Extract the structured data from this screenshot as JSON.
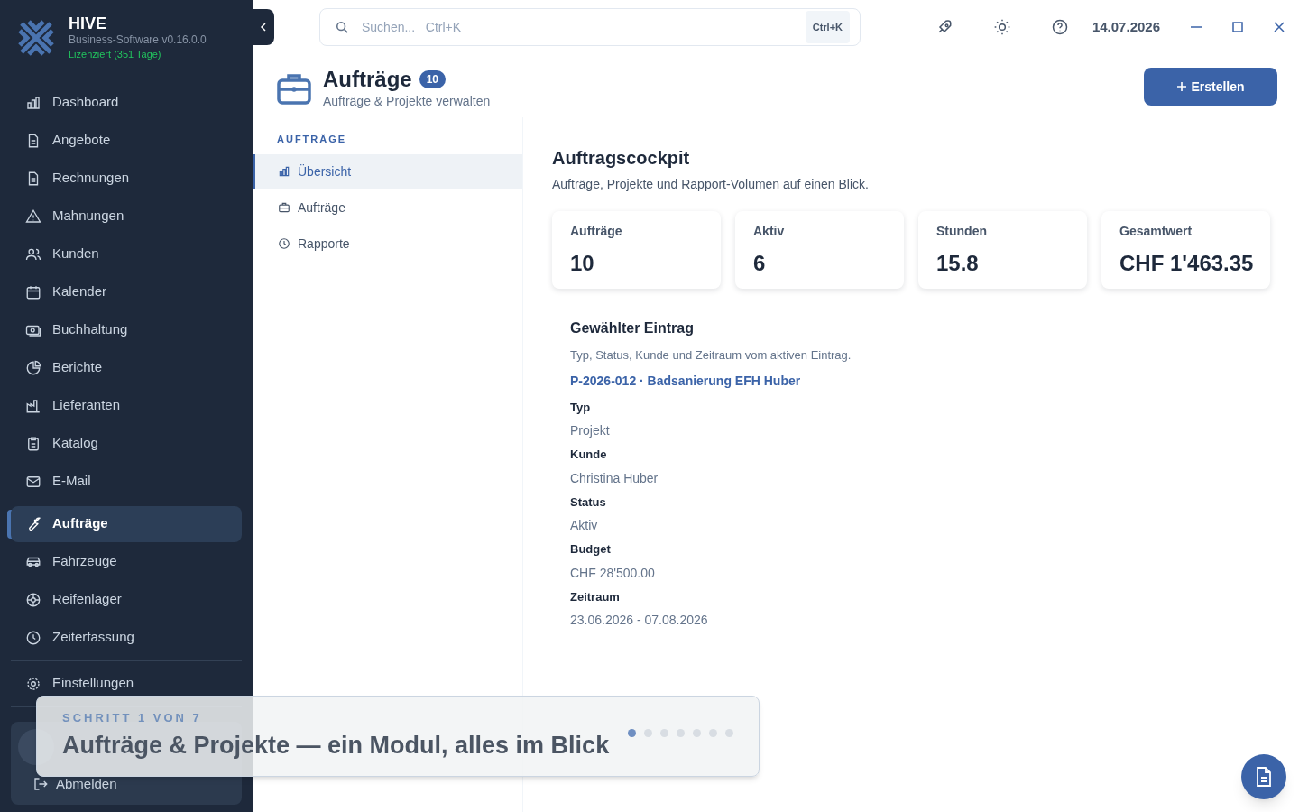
{
  "brand": {
    "name": "HIVE",
    "version": "Business-Software v0.16.0.0",
    "license": "Lizenziert (351 Tage)"
  },
  "nav": [
    {
      "label": "Dashboard",
      "selected": false
    },
    {
      "label": "Angebote",
      "selected": false
    },
    {
      "label": "Rechnungen",
      "selected": false
    },
    {
      "label": "Mahnungen",
      "selected": false
    },
    {
      "label": "Kunden",
      "selected": false
    },
    {
      "label": "Kalender",
      "selected": false
    },
    {
      "label": "Buchhaltung",
      "selected": false
    },
    {
      "label": "Berichte",
      "selected": false
    },
    {
      "label": "Lieferanten",
      "selected": false
    },
    {
      "label": "Katalog",
      "selected": false
    },
    {
      "label": "E-Mail",
      "selected": false
    },
    {
      "label": "Aufträge",
      "selected": true
    },
    {
      "label": "Fahrzeuge",
      "selected": false
    },
    {
      "label": "Reifenlager",
      "selected": false
    },
    {
      "label": "Zeiterfassung",
      "selected": false
    }
  ],
  "settings": "Einstellungen",
  "user": {
    "logout": "Abmelden"
  },
  "search": {
    "placeholder": "Suchen...   Ctrl+K",
    "shortcut": "Ctrl+K"
  },
  "date": "14.07.2026",
  "header": {
    "title": "Aufträge",
    "count": "10",
    "subtitle": "Aufträge & Projekte verwalten",
    "create": "Erstellen"
  },
  "subnav": {
    "heading": "AUFTRÄGE",
    "items": [
      {
        "label": "Übersicht",
        "selected": true
      },
      {
        "label": "Aufträge",
        "selected": false
      },
      {
        "label": "Rapporte",
        "selected": false
      }
    ]
  },
  "cockpit": {
    "title": "Auftragscockpit",
    "subtitle": "Aufträge, Projekte und Rapport-Volumen auf einen Blick."
  },
  "stats": [
    {
      "label": "Aufträge",
      "value": "10"
    },
    {
      "label": "Aktiv",
      "value": "6"
    },
    {
      "label": "Stunden",
      "value": "15.8"
    },
    {
      "label": "Gesamtwert",
      "value": "CHF 1'463.35"
    }
  ],
  "entry": {
    "title": "Gewählter Eintrag",
    "subtitle": "Typ, Status, Kunde und Zeitraum vom aktiven Eintrag.",
    "link": "P-2026-012 · Badsanierung EFH Huber",
    "fields": [
      {
        "label": "Typ",
        "value": "Projekt"
      },
      {
        "label": "Kunde",
        "value": "Christina Huber"
      },
      {
        "label": "Status",
        "value": "Aktiv"
      },
      {
        "label": "Budget",
        "value": "CHF 28'500.00"
      },
      {
        "label": "Zeitraum",
        "value": "23.06.2026 - 07.08.2026"
      }
    ]
  },
  "tour": {
    "step": "SCHRITT 1 VON 7",
    "title": "Aufträge & Projekte — ein Modul, alles im Blick",
    "dots": [
      {
        "selected": true
      },
      {
        "selected": false
      },
      {
        "selected": false
      },
      {
        "selected": false
      },
      {
        "selected": false
      },
      {
        "selected": false
      },
      {
        "selected": false
      }
    ]
  }
}
